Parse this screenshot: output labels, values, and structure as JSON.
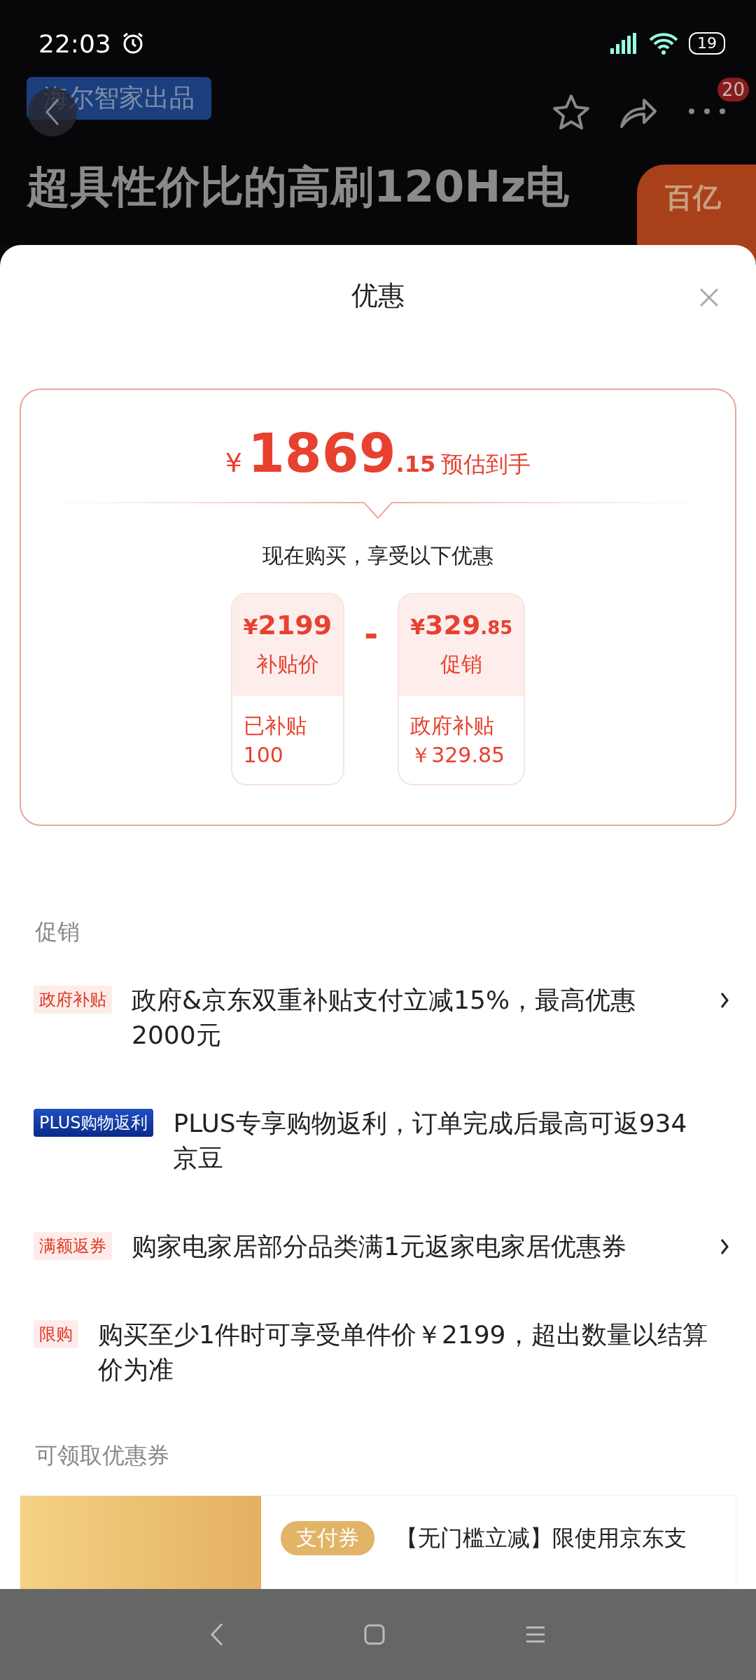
{
  "status_bar": {
    "time": "22:03",
    "battery": "19"
  },
  "product_page": {
    "brand_tag": "海尔智家出品",
    "notification_count": "20",
    "title": "超具性价比的高刷120Hz电",
    "sticker": "百亿"
  },
  "sheet": {
    "title": "优惠"
  },
  "estimate": {
    "currency": "¥",
    "integer": "1869",
    "decimal": ".15",
    "label": "预估到手",
    "subtitle": "现在购买，享受以下优惠",
    "operator": "-",
    "terms": [
      {
        "currency": "¥",
        "integer": "2199",
        "name": "补贴价",
        "detail": [
          "已补贴",
          "100"
        ]
      },
      {
        "currency": "¥",
        "integer": "329",
        "decimal": ".85",
        "name": "促销",
        "detail": [
          "政府补贴",
          "￥329.85"
        ]
      }
    ]
  },
  "promotions": {
    "heading": "促销",
    "items": [
      {
        "kind": "normal",
        "tag": "政府补贴",
        "text": "政府&京东双重补贴支付立减15%，最高优惠2000元",
        "arrow": true
      },
      {
        "kind": "plus",
        "tag": "PLUS购物返利",
        "text": "PLUS专享购物返利，订单完成后最高可返934京豆",
        "arrow": false
      },
      {
        "kind": "normal",
        "tag": "满额返券",
        "text": "购家电家居部分品类满1元返家电家居优惠券",
        "arrow": true
      },
      {
        "kind": "normal",
        "tag": "限购",
        "text": "购买至少1件时可享受单件价￥2199，超出数量以结算价为准",
        "arrow": false
      }
    ]
  },
  "coupons": {
    "heading": "可领取优惠券",
    "items": [
      {
        "tag": "支付券",
        "text": "【无门槛立减】限使用京东支"
      }
    ]
  }
}
